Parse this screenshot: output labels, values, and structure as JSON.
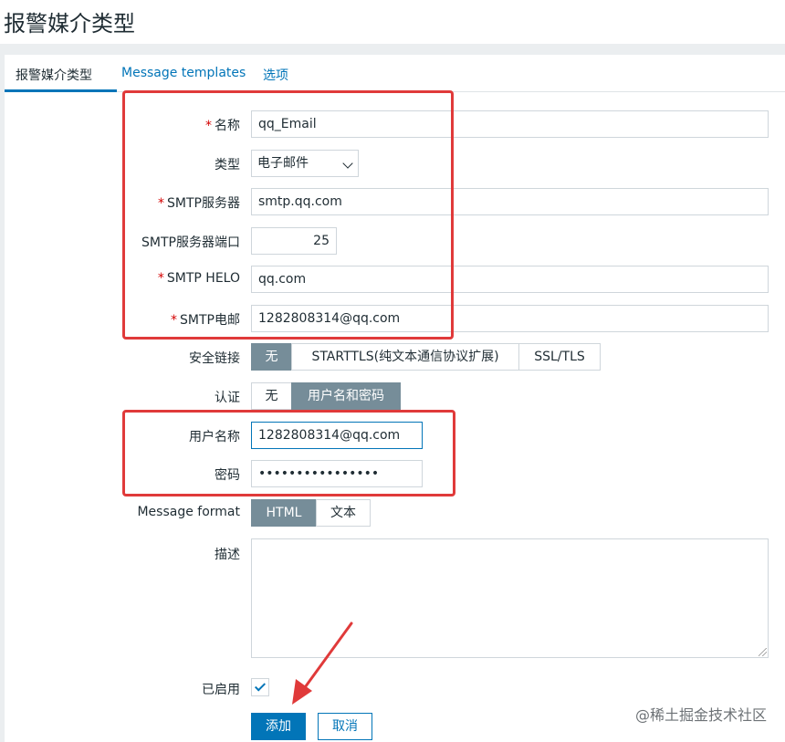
{
  "page": {
    "title": "报警媒介类型"
  },
  "tabs": [
    {
      "label": "报警媒介类型",
      "active": true
    },
    {
      "label": "Message templates",
      "active": false
    },
    {
      "label": "选项",
      "active": false
    }
  ],
  "form": {
    "name": {
      "label": "名称",
      "value": "qq_Email",
      "required": true
    },
    "type": {
      "label": "类型",
      "value": "电子邮件"
    },
    "smtp_server": {
      "label": "SMTP服务器",
      "value": "smtp.qq.com",
      "required": true
    },
    "smtp_port": {
      "label": "SMTP服务器端口",
      "value": "25"
    },
    "smtp_helo": {
      "label": "SMTP HELO",
      "value": "qq.com",
      "required": true
    },
    "smtp_email": {
      "label": "SMTP电邮",
      "value": "1282808314@qq.com",
      "required": true
    },
    "security": {
      "label": "安全链接",
      "options": [
        "无",
        "STARTTLS(纯文本通信协议扩展)",
        "SSL/TLS"
      ],
      "selected": "无"
    },
    "auth": {
      "label": "认证",
      "options": [
        "无",
        "用户名和密码"
      ],
      "selected": "用户名和密码"
    },
    "username": {
      "label": "用户名称",
      "value": "1282808314@qq.com"
    },
    "password": {
      "label": "密码",
      "value": "••••••••••••••••"
    },
    "message_format": {
      "label": "Message format",
      "options": [
        "HTML",
        "文本"
      ],
      "selected": "HTML"
    },
    "description": {
      "label": "描述",
      "value": ""
    },
    "enabled": {
      "label": "已启用",
      "checked": true
    }
  },
  "buttons": {
    "add": "添加",
    "cancel": "取消"
  },
  "watermark": "@稀土掘金技术社区",
  "colors": {
    "accent": "#0275b8",
    "segment_on": "#768d99",
    "required": "#d40000",
    "annotation": "#e03a3a"
  }
}
